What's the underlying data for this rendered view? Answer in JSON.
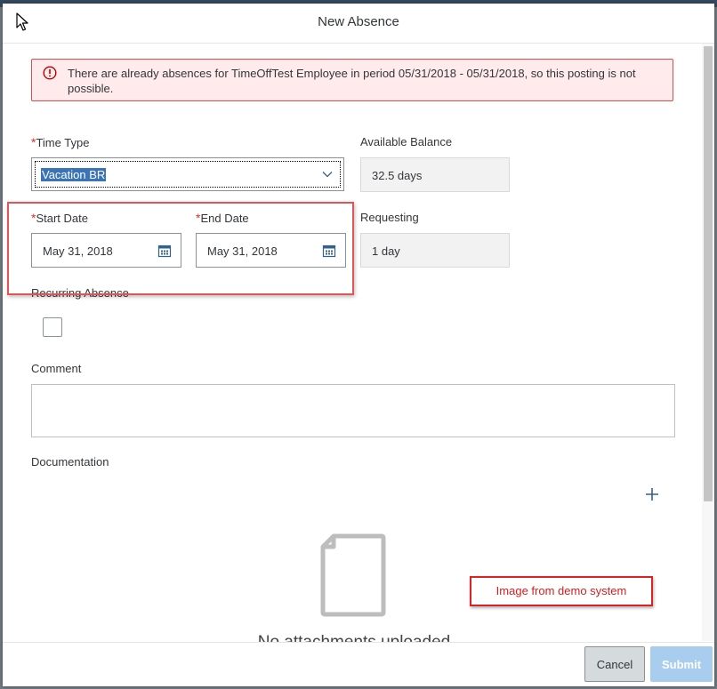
{
  "dialog": {
    "title": "New Absence"
  },
  "error": {
    "message": "There are already absences for TimeOffTest Employee in period 05/31/2018 - 05/31/2018, so this posting is not possible."
  },
  "form": {
    "required_marker": "*",
    "time_type": {
      "label": "Time Type",
      "value": "Vacation BR"
    },
    "available_balance": {
      "label": "Available Balance",
      "value": "32.5 days"
    },
    "start_date": {
      "label": "Start Date",
      "value": "May 31, 2018"
    },
    "end_date": {
      "label": "End Date",
      "value": "May 31, 2018"
    },
    "requesting": {
      "label": "Requesting",
      "value": "1 day"
    },
    "recurring_absence": {
      "label": "Recurring Absence",
      "checked": false
    },
    "comment": {
      "label": "Comment",
      "value": ""
    },
    "documentation": {
      "label": "Documentation",
      "empty_text": "No attachments uploaded"
    }
  },
  "annotation": {
    "text": "Image from demo system"
  },
  "footer": {
    "cancel_label": "Cancel",
    "submit_label": "Submit"
  },
  "colors": {
    "error_border": "#e34b4b",
    "error_background": "#ffebeb",
    "highlight_box": "#e45454",
    "submit_disabled": "#a9cdee",
    "selection": "#3a74b6"
  },
  "icons": [
    "cursor-icon",
    "error-icon",
    "chevron-down-icon",
    "calendar-icon",
    "add-icon",
    "document-icon"
  ]
}
